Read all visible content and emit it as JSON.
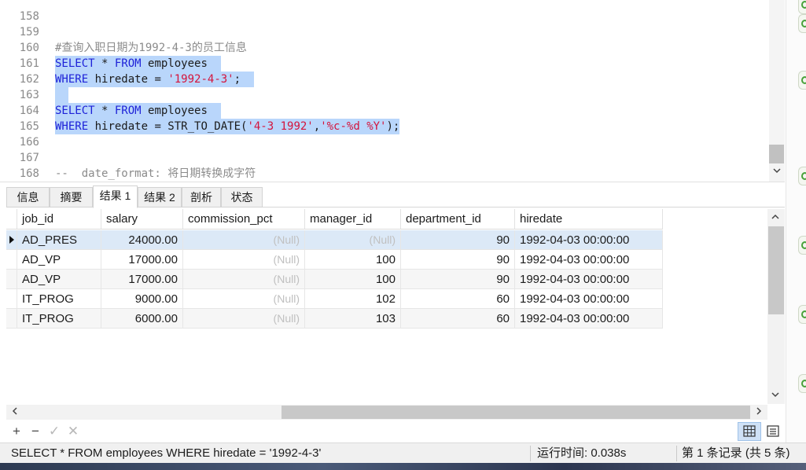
{
  "editor": {
    "lines": [
      {
        "num": "158"
      },
      {
        "num": "159",
        "comment": "#查询入职日期为1992-4-3的员工信息"
      },
      {
        "num": "160",
        "kw1": "SELECT",
        "t1": " * ",
        "kw2": "FROM",
        "t2": " employees"
      },
      {
        "num": "161",
        "kw1": "WHERE",
        "t1": " hiredate = ",
        "str1": "'1992-4-3'",
        "t2": ";"
      },
      {
        "num": "162"
      },
      {
        "num": "163",
        "kw1": "SELECT",
        "t1": " * ",
        "kw2": "FROM",
        "t2": " employees"
      },
      {
        "num": "164",
        "kw1": "WHERE",
        "t1": " hiredate = STR_TO_DATE(",
        "str1": "'4-3 1992'",
        "t2": ",",
        "str2": "'%c-%d %Y'",
        "t3": ");"
      },
      {
        "num": "165"
      },
      {
        "num": "166"
      },
      {
        "num": "167",
        "comment": "--  date_format: 将日期转换成字符"
      },
      {
        "num": "168"
      }
    ]
  },
  "tabs": [
    "信息",
    "摘要",
    "结果 1",
    "结果 2",
    "剖析",
    "状态"
  ],
  "active_tab": "结果 1",
  "grid": {
    "columns": [
      "job_id",
      "salary",
      "commission_pct",
      "manager_id",
      "department_id",
      "hiredate"
    ],
    "rows": [
      [
        "AD_PRES",
        "24000.00",
        "(Null)",
        "(Null)",
        "90",
        "1992-04-03 00:00:00"
      ],
      [
        "AD_VP",
        "17000.00",
        "(Null)",
        "100",
        "90",
        "1992-04-03 00:00:00"
      ],
      [
        "AD_VP",
        "17000.00",
        "(Null)",
        "100",
        "90",
        "1992-04-03 00:00:00"
      ],
      [
        "IT_PROG",
        "9000.00",
        "(Null)",
        "102",
        "60",
        "1992-04-03 00:00:00"
      ],
      [
        "IT_PROG",
        "6000.00",
        "(Null)",
        "103",
        "60",
        "1992-04-03 00:00:00"
      ]
    ]
  },
  "toolbar": {
    "add": "+",
    "remove": "−",
    "apply": "✓",
    "cancel": "✕"
  },
  "status": {
    "query": "SELECT * FROM employees  WHERE hiredate = '1992-4-3'",
    "runtime": "运行时间: 0.038s",
    "records": "第 1 条记录 (共 5 条)"
  },
  "colors": {
    "selection": "#b9d6fb",
    "keyword": "#1e22d8",
    "string": "#d4143c",
    "comment": "#8b8b8b"
  },
  "icons": [
    "chevron-up-icon",
    "chevron-down-icon",
    "chevron-left-icon",
    "chevron-right-icon",
    "row-pointer-icon",
    "grid-view-icon",
    "form-view-icon",
    "refresh-icon"
  ]
}
